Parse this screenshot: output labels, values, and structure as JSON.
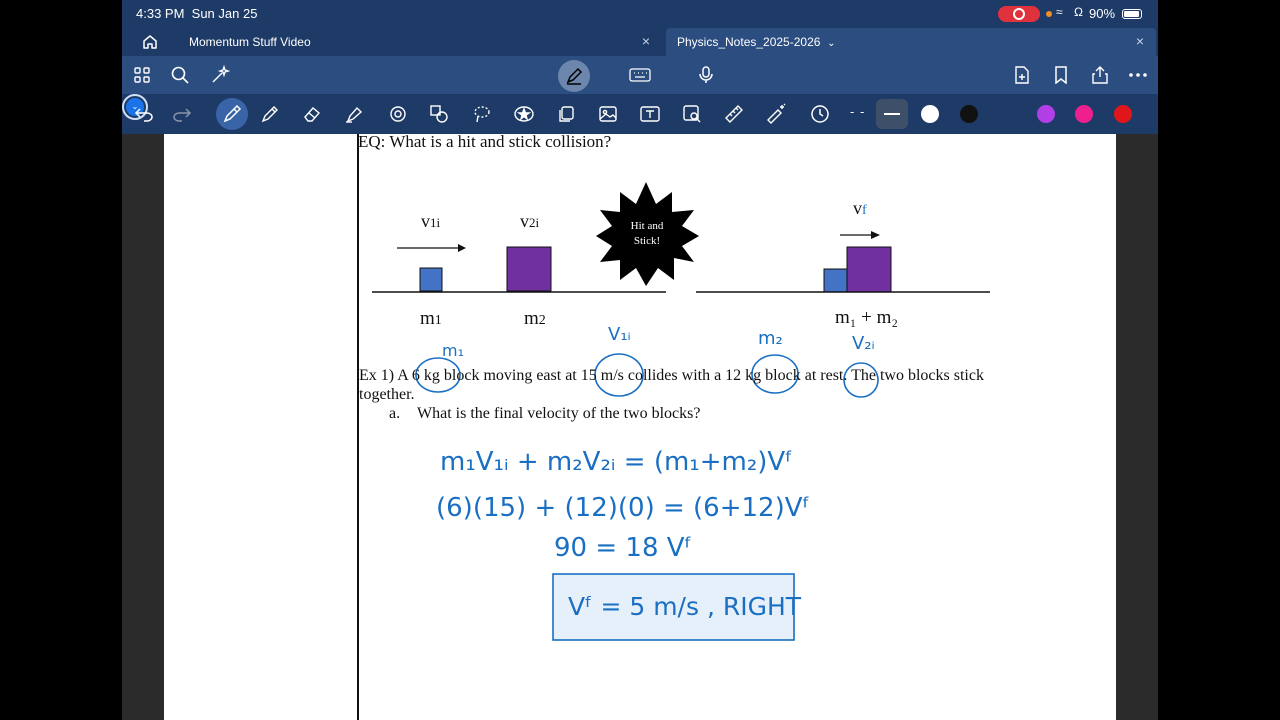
{
  "status": {
    "time": "4:33 PM",
    "date": "Sun Jan 25",
    "battery": "90%"
  },
  "tabs": [
    {
      "label": "Momentum Stuff Video"
    },
    {
      "label": "Physics_Notes_2025-2026",
      "active": true
    }
  ],
  "icons": {
    "top_toolbar": [
      "grid-icon",
      "search-icon",
      "sparkle-icon",
      "pen-mode-icon",
      "keyboard-icon",
      "microphone-icon",
      "add-page-icon",
      "bookmark-icon",
      "share-icon",
      "more-icon"
    ],
    "tools": [
      "undo-icon",
      "redo-icon",
      "pen-icon",
      "pencil-icon",
      "eraser-icon",
      "highlighter-icon",
      "shapes-icon",
      "elements-icon",
      "lasso-icon",
      "sticker-icon",
      "copy-icon",
      "image-icon",
      "text-icon",
      "scan-icon",
      "ruler-icon",
      "laser-icon",
      "timer-icon"
    ]
  },
  "colors": {
    "swatches": [
      "#ffffff",
      "#111111",
      "#1a73e8",
      "#b13ee6",
      "#ef1f8f",
      "#e0161b"
    ],
    "selected": "#1a73e8",
    "ink": "#1a6fc2",
    "block1": "#4472c4",
    "block2": "#7030a0"
  },
  "document": {
    "eq": "EQ: What is a hit and stick collision?",
    "diagram": {
      "v1i_label": "v",
      "v1i_sub": "1i",
      "v2i_label": "v",
      "v2i_sub": "2i",
      "m1_label": "m",
      "m1_sub": "1",
      "m2_label": "m",
      "m2_sub": "2",
      "burst_line1": "Hit and",
      "burst_line2": "Stick!",
      "vf_label": "v",
      "vf_sub": "f",
      "combined_label": "m₁ + m₂"
    },
    "ex1_text": "Ex 1) A 6 kg block moving east at 15 m/s collides with a 12 kg block at rest.  The two blocks stick together.",
    "question_num": "a.",
    "question_text": "What is the final velocity of the two blocks?",
    "handwriting": {
      "ann_m1": "m₁",
      "ann_v1i": "V₁ᵢ",
      "ann_m2": "m₂",
      "ann_v2i": "V₂ᵢ",
      "line1": "m₁V₁ᵢ + m₂V₂ᵢ = (m₁+m₂)Vᶠ",
      "line2": "(6)(15) + (12)(0) = (6+12)Vᶠ",
      "line3": "90 = 18 Vᶠ",
      "answer": "Vᶠ = 5 m/s , RIGHT"
    }
  }
}
